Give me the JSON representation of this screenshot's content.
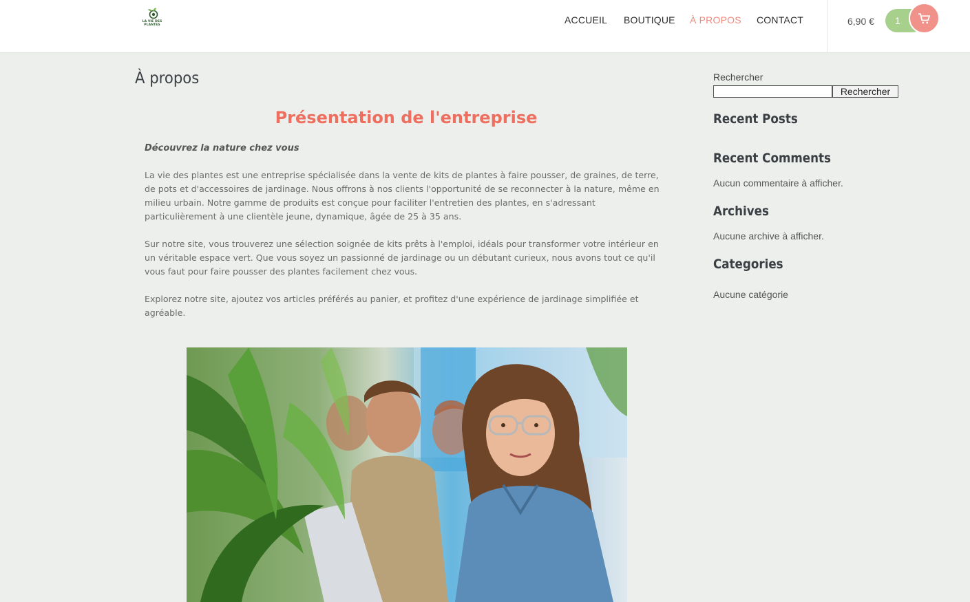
{
  "header": {
    "logo_text": "LA VIE DES PLANTES",
    "nav": [
      {
        "label": "ACCUEIL"
      },
      {
        "label": "BOUTIQUE"
      },
      {
        "label": "À PROPOS"
      },
      {
        "label": "CONTACT"
      }
    ],
    "cart": {
      "total": "6,90 €",
      "count": "1",
      "icon": "shopping-cart-icon"
    }
  },
  "main": {
    "page_title": "À propos",
    "section_title": "Présentation de l'entreprise",
    "tagline": "Découvrez la nature chez vous",
    "paragraphs": [
      "La vie des plantes est une entreprise spécialisée dans la vente de kits de plantes à faire pousser, de graines, de terre, de pots et d'accessoires de jardinage. Nous offrons à nos clients l'opportunité de se reconnecter à la nature, même en milieu urbain. Notre gamme de produits est conçue pour faciliter l'entretien des plantes, en s'adressant particulièrement à une clientèle jeune, dynamique, âgée de 25 à 35 ans.",
      "Sur notre site, vous trouverez une sélection soignée de kits prêts à l'emploi, idéals pour transformer votre intérieur en un véritable espace vert. Que vous soyez un passionné de jardinage ou un débutant curieux, nous avons tout ce qu'il vous faut pour faire pousser des plantes facilement chez vous.",
      "Explorez notre site, ajoutez vos articles préférés au panier, et profitez d'une expérience de jardinage simplifiée et agréable."
    ]
  },
  "sidebar": {
    "search": {
      "label": "Rechercher",
      "value": "",
      "button": "Rechercher"
    },
    "recent_posts": {
      "title": "Recent Posts"
    },
    "recent_comments": {
      "title": "Recent Comments",
      "empty": "Aucun commentaire à afficher."
    },
    "archives": {
      "title": "Archives",
      "empty": "Aucune archive à afficher."
    },
    "categories": {
      "title": "Categories",
      "empty": "Aucune catégorie"
    }
  },
  "colors": {
    "accent": "#ee6f5f",
    "nav_active": "#ee8b7d",
    "cart_count_bg": "#a8d08d",
    "cart_button_bg": "#f0928a",
    "page_bg": "#ecefeb"
  }
}
